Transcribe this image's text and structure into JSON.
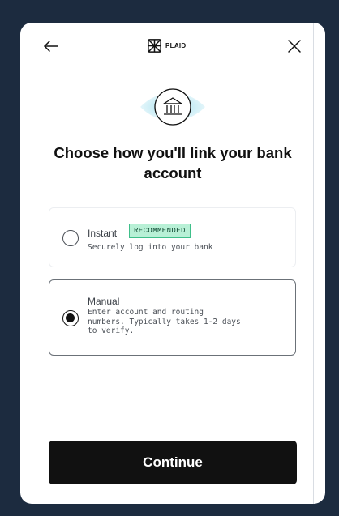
{
  "header": {
    "brand": "PLAID"
  },
  "main": {
    "heading": "Choose how you'll link your bank account",
    "options": [
      {
        "title": "Instant",
        "badge": "RECOMMENDED",
        "description": "Securely log into your bank",
        "selected": false
      },
      {
        "title": "Manual",
        "description": "Enter account and routing numbers. Typically takes 1-2 days to verify.",
        "selected": true
      }
    ],
    "continue_label": "Continue"
  },
  "colors": {
    "background": "#1c2b3f",
    "modal": "#ffffff",
    "badge_fill": "#b8f0d6",
    "badge_border": "#3fbf8a",
    "primary_button": "#111111",
    "hero_accent": "#7fd3e8"
  },
  "icons": {
    "back": "arrow-left-icon",
    "close": "close-icon",
    "logo": "plaid-logo-icon",
    "bank": "bank-icon"
  }
}
